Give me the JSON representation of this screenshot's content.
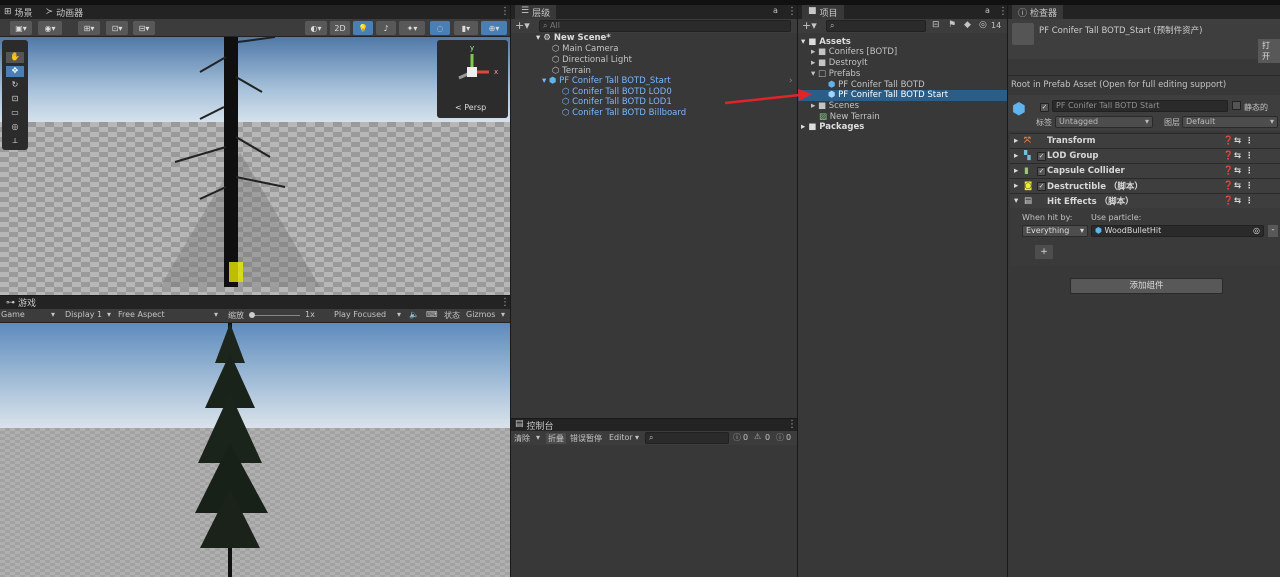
{
  "scene_tab": {
    "label": "场景",
    "animator": "动画器"
  },
  "scene_toolbar": {
    "mode_2d": "2D"
  },
  "gizmo": {
    "persp": "< Persp",
    "axis_y": "y",
    "axis_x": "x"
  },
  "game_tab": {
    "label": "游戏"
  },
  "game_toolbar": {
    "game": "Game",
    "display": "Display 1",
    "aspect": "Free Aspect",
    "scale_label": "缩放",
    "scale_value": "1x",
    "play_mode": "Play Focused",
    "stats": "状态",
    "gizmos": "Gizmos"
  },
  "hierarchy": {
    "tab": "层级",
    "search_placeholder": "All",
    "scene": "New Scene*",
    "items": [
      "Main Camera",
      "Directional Light",
      "Terrain"
    ],
    "prefab": "PF Conifer Tall BOTD_Start",
    "children": [
      "Conifer Tall BOTD LOD0",
      "Conifer Tall BOTD LOD1",
      "Conifer Tall BOTD Billboard"
    ]
  },
  "console": {
    "tab": "控制台",
    "clear": "清除",
    "collapse": "折叠",
    "error_pause": "错误暂停",
    "editor": "Editor",
    "count_info": "0",
    "count_warn": "0",
    "count_err": "0"
  },
  "project": {
    "tab": "项目",
    "hidden_count": "14",
    "assets": "Assets",
    "folders": [
      "Conifers [BOTD]",
      "DestroyIt",
      "Prefabs"
    ],
    "prefabs": [
      "PF Conifer Tall BOTD",
      "PF Conifer Tall BOTD Start"
    ],
    "more": [
      "Scenes",
      "New Terrain"
    ],
    "packages": "Packages"
  },
  "inspector": {
    "tab": "检查器",
    "title": "PF Conifer Tall BOTD_Start (预制件资产)",
    "open_btn": "打开",
    "root_note": "Root in Prefab Asset (Open for full editing support)",
    "name": "PF Conifer Tall BOTD Start",
    "static_label": "静态的",
    "tag_label": "标签",
    "tag_value": "Untagged",
    "layer_label": "图层",
    "layer_value": "Default",
    "components": [
      "Transform",
      "LOD Group",
      "Capsule Collider",
      "Destructible （脚本）",
      "Hit Effects （脚本）"
    ],
    "hit_by_label": "When hit by:",
    "particle_label": "Use particle:",
    "hit_by_value": "Everything",
    "particle_value": "WoodBulletHit",
    "plus": "+",
    "minus": "-",
    "add_component": "添加组件"
  },
  "colors": {
    "accent": "#2c5d87",
    "annotation_arrow": "#e0242a"
  }
}
